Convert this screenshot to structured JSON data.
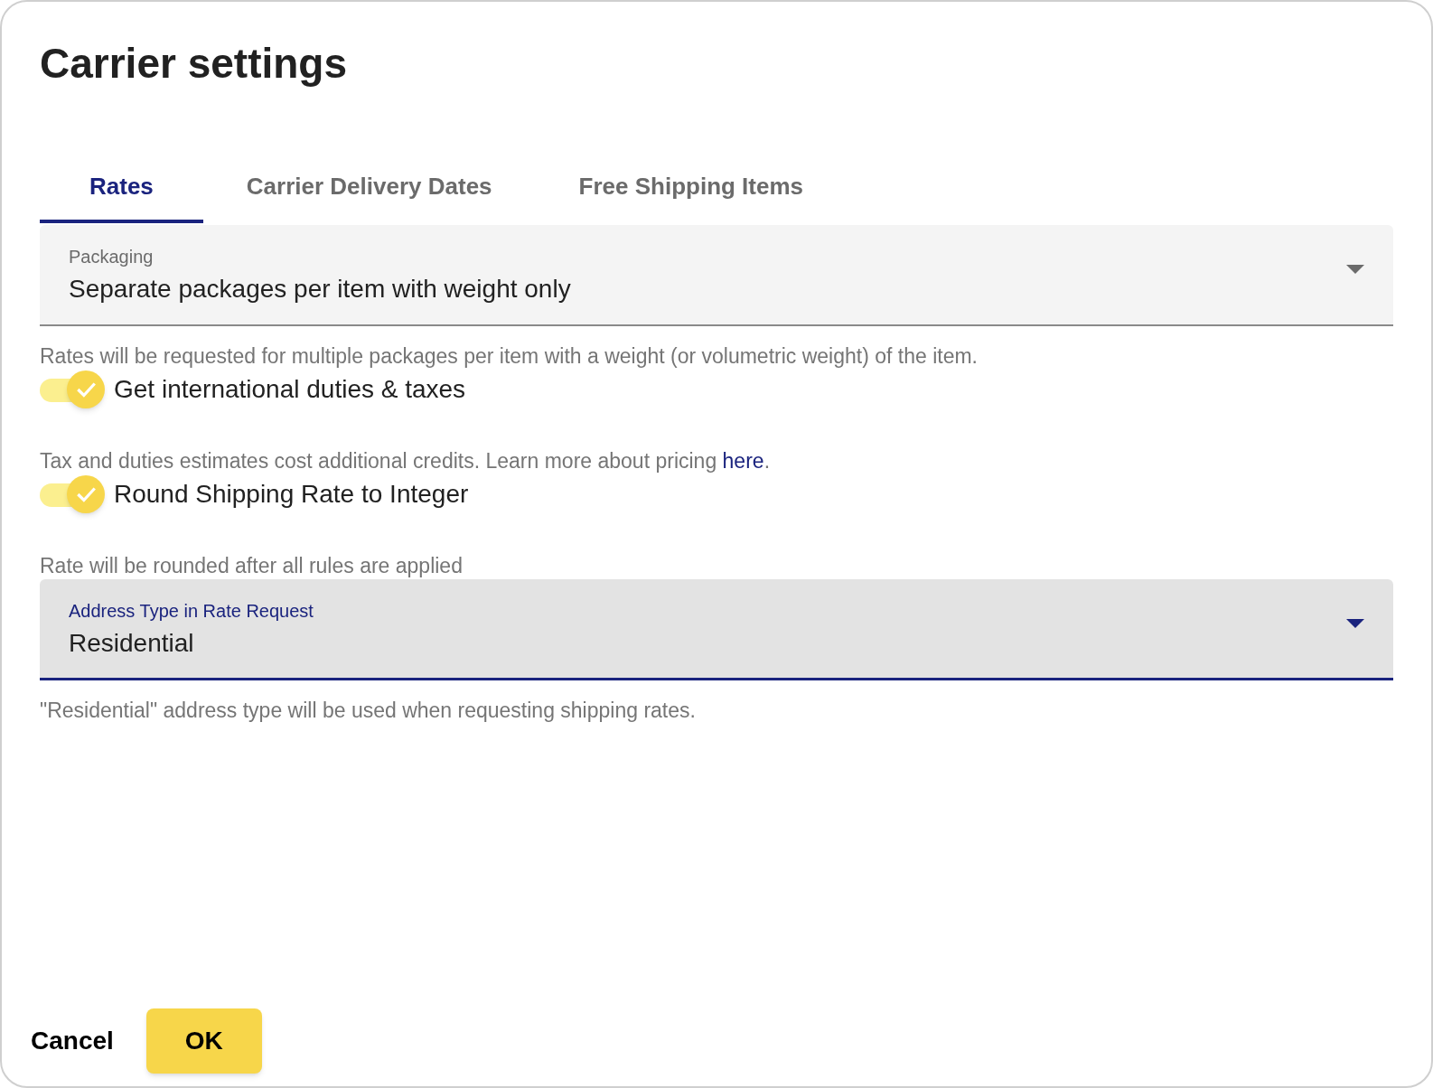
{
  "dialog": {
    "title": "Carrier settings"
  },
  "tabs": [
    {
      "label": "Rates",
      "selected": true
    },
    {
      "label": "Carrier Delivery Dates",
      "selected": false
    },
    {
      "label": "Free Shipping Items",
      "selected": false
    }
  ],
  "items": [
    {
      "kind": "select",
      "label": "Packaging",
      "value": "Separate packages per item with weight only",
      "focused": false
    },
    {
      "kind": "hint",
      "text": "Rates will be requested for multiple packages per item with a weight (or volumetric weight) of the item."
    },
    {
      "kind": "toggle",
      "label": "Get international duties & taxes",
      "on": true
    },
    {
      "kind": "hint",
      "text": "Tax and duties estimates cost additional credits. Learn more about pricing ",
      "link": "here",
      "after": "."
    },
    {
      "kind": "toggle",
      "label": "Round Shipping Rate to Integer",
      "on": true
    },
    {
      "kind": "hint",
      "text": "Rate will be rounded after all rules are applied"
    },
    {
      "kind": "select",
      "label": "Address Type in Rate Request",
      "value": "Residential",
      "focused": true
    },
    {
      "kind": "hint",
      "text": "\"Residential\" address type will be used when requesting shipping rates."
    }
  ],
  "buttons": [
    {
      "label": "Cancel",
      "kind": "text"
    },
    {
      "label": "OK",
      "kind": "filled"
    }
  ]
}
